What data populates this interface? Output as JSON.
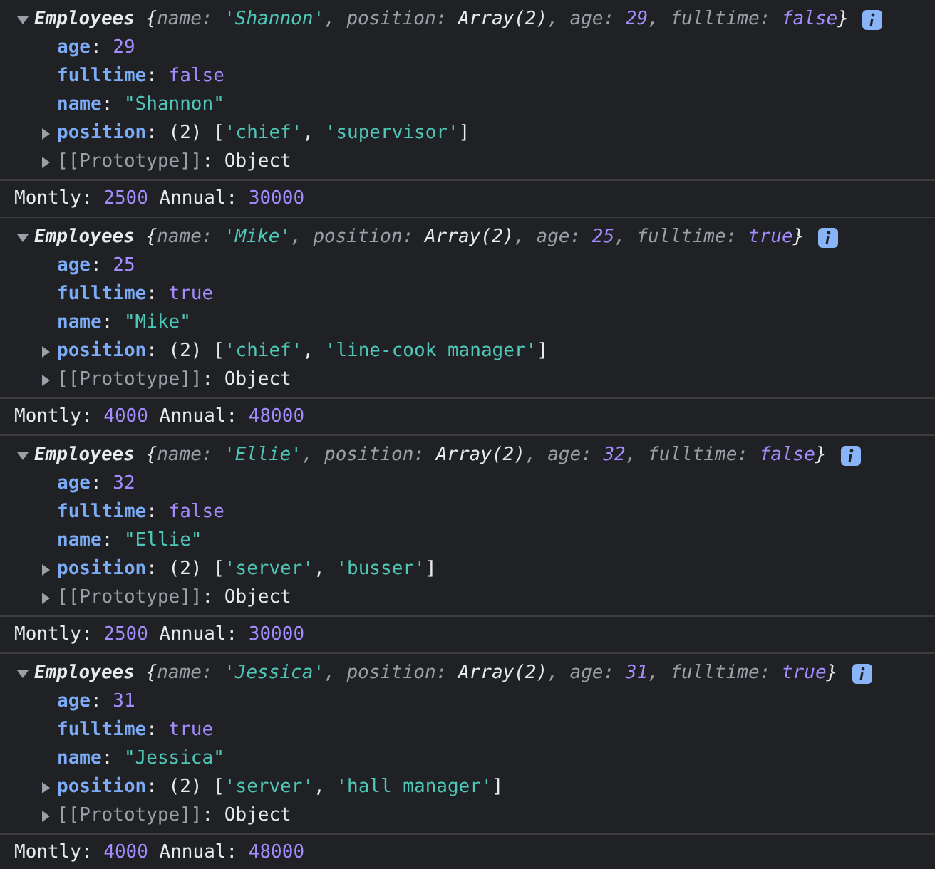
{
  "entries": [
    {
      "object": {
        "expanded": true,
        "preview": [
          {
            "t": "Employees",
            "kind": "class"
          },
          {
            "t": " {",
            "kind": "plain"
          },
          {
            "t": "name",
            "kind": "pkey"
          },
          {
            "t": ": ",
            "kind": "punct"
          },
          {
            "t": "'Shannon'",
            "kind": "string"
          },
          {
            "t": ", ",
            "kind": "punct"
          },
          {
            "t": "position",
            "kind": "pkey"
          },
          {
            "t": ": ",
            "kind": "punct"
          },
          {
            "t": "Array(2)",
            "kind": "plain"
          },
          {
            "t": ", ",
            "kind": "punct"
          },
          {
            "t": "age",
            "kind": "pkey"
          },
          {
            "t": ": ",
            "kind": "punct"
          },
          {
            "t": "29",
            "kind": "number"
          },
          {
            "t": ", ",
            "kind": "punct"
          },
          {
            "t": "fulltime",
            "kind": "pkey"
          },
          {
            "t": ": ",
            "kind": "punct"
          },
          {
            "t": "false",
            "kind": "number"
          },
          {
            "t": "}",
            "kind": "plain"
          }
        ],
        "properties": [
          {
            "kind": "leaf",
            "key": "age",
            "value": [
              {
                "t": ": ",
                "kind": "plain"
              },
              {
                "t": "29",
                "kind": "number"
              }
            ]
          },
          {
            "kind": "leaf",
            "key": "fulltime",
            "value": [
              {
                "t": ": ",
                "kind": "plain"
              },
              {
                "t": "false",
                "kind": "number"
              }
            ]
          },
          {
            "kind": "leaf",
            "key": "name",
            "value": [
              {
                "t": ": ",
                "kind": "plain"
              },
              {
                "t": "\"Shannon\"",
                "kind": "string"
              }
            ]
          },
          {
            "kind": "expandable",
            "expanded": false,
            "key": "position",
            "value": [
              {
                "t": ": ",
                "kind": "plain"
              },
              {
                "t": "(2) ",
                "kind": "plain"
              },
              {
                "t": "[",
                "kind": "plain"
              },
              {
                "t": "'chief'",
                "kind": "string"
              },
              {
                "t": ", ",
                "kind": "plain"
              },
              {
                "t": "'supervisor'",
                "kind": "string"
              },
              {
                "t": "]",
                "kind": "plain"
              }
            ]
          },
          {
            "kind": "internal",
            "expanded": false,
            "key": "[[Prototype]]",
            "value": [
              {
                "t": ": ",
                "kind": "plain"
              },
              {
                "t": "Object",
                "kind": "plain"
              }
            ]
          }
        ]
      },
      "log": [
        {
          "t": "Montly: ",
          "kind": "plain"
        },
        {
          "t": "2500",
          "kind": "number"
        },
        {
          "t": " Annual: ",
          "kind": "plain"
        },
        {
          "t": "30000",
          "kind": "number"
        }
      ]
    },
    {
      "object": {
        "expanded": true,
        "preview": [
          {
            "t": "Employees",
            "kind": "class"
          },
          {
            "t": " {",
            "kind": "plain"
          },
          {
            "t": "name",
            "kind": "pkey"
          },
          {
            "t": ": ",
            "kind": "punct"
          },
          {
            "t": "'Mike'",
            "kind": "string"
          },
          {
            "t": ", ",
            "kind": "punct"
          },
          {
            "t": "position",
            "kind": "pkey"
          },
          {
            "t": ": ",
            "kind": "punct"
          },
          {
            "t": "Array(2)",
            "kind": "plain"
          },
          {
            "t": ", ",
            "kind": "punct"
          },
          {
            "t": "age",
            "kind": "pkey"
          },
          {
            "t": ": ",
            "kind": "punct"
          },
          {
            "t": "25",
            "kind": "number"
          },
          {
            "t": ", ",
            "kind": "punct"
          },
          {
            "t": "fulltime",
            "kind": "pkey"
          },
          {
            "t": ": ",
            "kind": "punct"
          },
          {
            "t": "true",
            "kind": "number"
          },
          {
            "t": "}",
            "kind": "plain"
          }
        ],
        "properties": [
          {
            "kind": "leaf",
            "key": "age",
            "value": [
              {
                "t": ": ",
                "kind": "plain"
              },
              {
                "t": "25",
                "kind": "number"
              }
            ]
          },
          {
            "kind": "leaf",
            "key": "fulltime",
            "value": [
              {
                "t": ": ",
                "kind": "plain"
              },
              {
                "t": "true",
                "kind": "number"
              }
            ]
          },
          {
            "kind": "leaf",
            "key": "name",
            "value": [
              {
                "t": ": ",
                "kind": "plain"
              },
              {
                "t": "\"Mike\"",
                "kind": "string"
              }
            ]
          },
          {
            "kind": "expandable",
            "expanded": false,
            "key": "position",
            "value": [
              {
                "t": ": ",
                "kind": "plain"
              },
              {
                "t": "(2) ",
                "kind": "plain"
              },
              {
                "t": "[",
                "kind": "plain"
              },
              {
                "t": "'chief'",
                "kind": "string"
              },
              {
                "t": ", ",
                "kind": "plain"
              },
              {
                "t": "'line-cook manager'",
                "kind": "string"
              },
              {
                "t": "]",
                "kind": "plain"
              }
            ]
          },
          {
            "kind": "internal",
            "expanded": false,
            "key": "[[Prototype]]",
            "value": [
              {
                "t": ": ",
                "kind": "plain"
              },
              {
                "t": "Object",
                "kind": "plain"
              }
            ]
          }
        ]
      },
      "log": [
        {
          "t": "Montly: ",
          "kind": "plain"
        },
        {
          "t": "4000",
          "kind": "number"
        },
        {
          "t": " Annual: ",
          "kind": "plain"
        },
        {
          "t": "48000",
          "kind": "number"
        }
      ]
    },
    {
      "object": {
        "expanded": true,
        "preview": [
          {
            "t": "Employees",
            "kind": "class"
          },
          {
            "t": " {",
            "kind": "plain"
          },
          {
            "t": "name",
            "kind": "pkey"
          },
          {
            "t": ": ",
            "kind": "punct"
          },
          {
            "t": "'Ellie'",
            "kind": "string"
          },
          {
            "t": ", ",
            "kind": "punct"
          },
          {
            "t": "position",
            "kind": "pkey"
          },
          {
            "t": ": ",
            "kind": "punct"
          },
          {
            "t": "Array(2)",
            "kind": "plain"
          },
          {
            "t": ", ",
            "kind": "punct"
          },
          {
            "t": "age",
            "kind": "pkey"
          },
          {
            "t": ": ",
            "kind": "punct"
          },
          {
            "t": "32",
            "kind": "number"
          },
          {
            "t": ", ",
            "kind": "punct"
          },
          {
            "t": "fulltime",
            "kind": "pkey"
          },
          {
            "t": ": ",
            "kind": "punct"
          },
          {
            "t": "false",
            "kind": "number"
          },
          {
            "t": "}",
            "kind": "plain"
          }
        ],
        "properties": [
          {
            "kind": "leaf",
            "key": "age",
            "value": [
              {
                "t": ": ",
                "kind": "plain"
              },
              {
                "t": "32",
                "kind": "number"
              }
            ]
          },
          {
            "kind": "leaf",
            "key": "fulltime",
            "value": [
              {
                "t": ": ",
                "kind": "plain"
              },
              {
                "t": "false",
                "kind": "number"
              }
            ]
          },
          {
            "kind": "leaf",
            "key": "name",
            "value": [
              {
                "t": ": ",
                "kind": "plain"
              },
              {
                "t": "\"Ellie\"",
                "kind": "string"
              }
            ]
          },
          {
            "kind": "expandable",
            "expanded": false,
            "key": "position",
            "value": [
              {
                "t": ": ",
                "kind": "plain"
              },
              {
                "t": "(2) ",
                "kind": "plain"
              },
              {
                "t": "[",
                "kind": "plain"
              },
              {
                "t": "'server'",
                "kind": "string"
              },
              {
                "t": ", ",
                "kind": "plain"
              },
              {
                "t": "'busser'",
                "kind": "string"
              },
              {
                "t": "]",
                "kind": "plain"
              }
            ]
          },
          {
            "kind": "internal",
            "expanded": false,
            "key": "[[Prototype]]",
            "value": [
              {
                "t": ": ",
                "kind": "plain"
              },
              {
                "t": "Object",
                "kind": "plain"
              }
            ]
          }
        ]
      },
      "log": [
        {
          "t": "Montly: ",
          "kind": "plain"
        },
        {
          "t": "2500",
          "kind": "number"
        },
        {
          "t": " Annual: ",
          "kind": "plain"
        },
        {
          "t": "30000",
          "kind": "number"
        }
      ]
    },
    {
      "object": {
        "expanded": true,
        "preview": [
          {
            "t": "Employees",
            "kind": "class"
          },
          {
            "t": " {",
            "kind": "plain"
          },
          {
            "t": "name",
            "kind": "pkey"
          },
          {
            "t": ": ",
            "kind": "punct"
          },
          {
            "t": "'Jessica'",
            "kind": "string"
          },
          {
            "t": ", ",
            "kind": "punct"
          },
          {
            "t": "position",
            "kind": "pkey"
          },
          {
            "t": ": ",
            "kind": "punct"
          },
          {
            "t": "Array(2)",
            "kind": "plain"
          },
          {
            "t": ", ",
            "kind": "punct"
          },
          {
            "t": "age",
            "kind": "pkey"
          },
          {
            "t": ": ",
            "kind": "punct"
          },
          {
            "t": "31",
            "kind": "number"
          },
          {
            "t": ", ",
            "kind": "punct"
          },
          {
            "t": "fulltime",
            "kind": "pkey"
          },
          {
            "t": ": ",
            "kind": "punct"
          },
          {
            "t": "true",
            "kind": "number"
          },
          {
            "t": "}",
            "kind": "plain"
          }
        ],
        "properties": [
          {
            "kind": "leaf",
            "key": "age",
            "value": [
              {
                "t": ": ",
                "kind": "plain"
              },
              {
                "t": "31",
                "kind": "number"
              }
            ]
          },
          {
            "kind": "leaf",
            "key": "fulltime",
            "value": [
              {
                "t": ": ",
                "kind": "plain"
              },
              {
                "t": "true",
                "kind": "number"
              }
            ]
          },
          {
            "kind": "leaf",
            "key": "name",
            "value": [
              {
                "t": ": ",
                "kind": "plain"
              },
              {
                "t": "\"Jessica\"",
                "kind": "string"
              }
            ]
          },
          {
            "kind": "expandable",
            "expanded": false,
            "key": "position",
            "value": [
              {
                "t": ": ",
                "kind": "plain"
              },
              {
                "t": "(2) ",
                "kind": "plain"
              },
              {
                "t": "[",
                "kind": "plain"
              },
              {
                "t": "'server'",
                "kind": "string"
              },
              {
                "t": ", ",
                "kind": "plain"
              },
              {
                "t": "'hall manager'",
                "kind": "string"
              },
              {
                "t": "]",
                "kind": "plain"
              }
            ]
          },
          {
            "kind": "internal",
            "expanded": false,
            "key": "[[Prototype]]",
            "value": [
              {
                "t": ": ",
                "kind": "plain"
              },
              {
                "t": "Object",
                "kind": "plain"
              }
            ]
          }
        ]
      },
      "log": [
        {
          "t": "Montly: ",
          "kind": "plain"
        },
        {
          "t": "4000",
          "kind": "number"
        },
        {
          "t": " Annual: ",
          "kind": "plain"
        },
        {
          "t": "48000",
          "kind": "number"
        }
      ]
    }
  ]
}
